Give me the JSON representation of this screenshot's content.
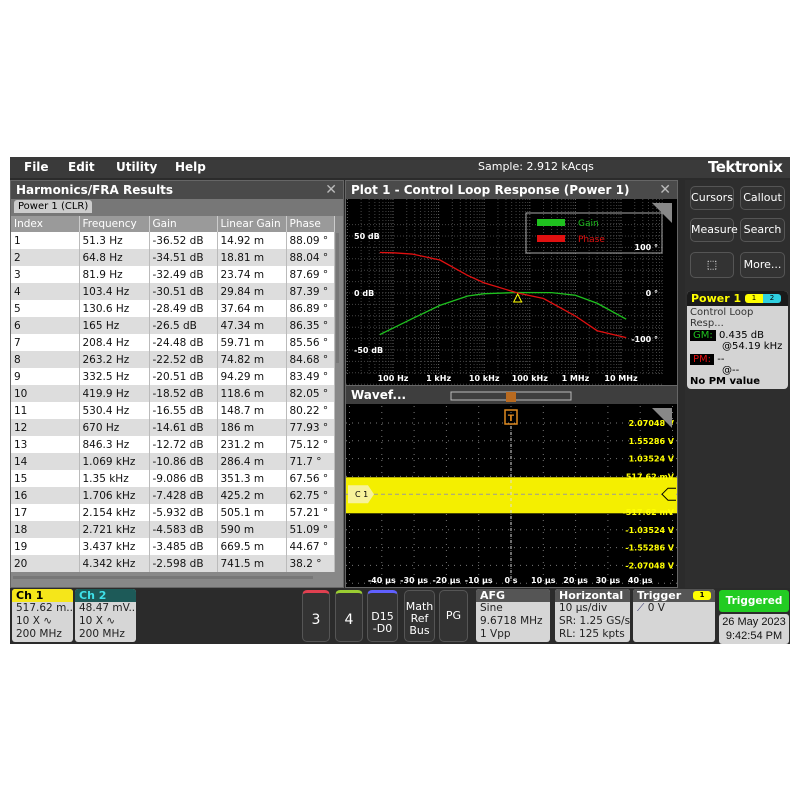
{
  "menu": {
    "items": [
      "File",
      "Edit",
      "Utility",
      "Help"
    ],
    "status": "Sample: 2.912 kAcqs",
    "brand": "Tektronix"
  },
  "results": {
    "title": "Harmonics/FRA Results",
    "tab": "Power 1 (CLR)",
    "columns": [
      "Index",
      "Frequency",
      "Gain",
      "Linear Gain",
      "Phase"
    ],
    "rows": [
      [
        "1",
        "51.3 Hz",
        "-36.52 dB",
        "14.92 m",
        "88.09 °"
      ],
      [
        "2",
        "64.8 Hz",
        "-34.51 dB",
        "18.81 m",
        "88.04 °"
      ],
      [
        "3",
        "81.9 Hz",
        "-32.49 dB",
        "23.74 m",
        "87.69 °"
      ],
      [
        "4",
        "103.4 Hz",
        "-30.51 dB",
        "29.84 m",
        "87.39 °"
      ],
      [
        "5",
        "130.6 Hz",
        "-28.49 dB",
        "37.64 m",
        "86.89 °"
      ],
      [
        "6",
        "165 Hz",
        "-26.5 dB",
        "47.34 m",
        "86.35 °"
      ],
      [
        "7",
        "208.4 Hz",
        "-24.48 dB",
        "59.71 m",
        "85.56 °"
      ],
      [
        "8",
        "263.2 Hz",
        "-22.52 dB",
        "74.82 m",
        "84.68 °"
      ],
      [
        "9",
        "332.5 Hz",
        "-20.51 dB",
        "94.29 m",
        "83.49 °"
      ],
      [
        "10",
        "419.9 Hz",
        "-18.52 dB",
        "118.6 m",
        "82.05 °"
      ],
      [
        "11",
        "530.4 Hz",
        "-16.55 dB",
        "148.7 m",
        "80.22 °"
      ],
      [
        "12",
        "670 Hz",
        "-14.61 dB",
        "186 m",
        "77.93 °"
      ],
      [
        "13",
        "846.3 Hz",
        "-12.72 dB",
        "231.2 m",
        "75.12 °"
      ],
      [
        "14",
        "1.069 kHz",
        "-10.86 dB",
        "286.4 m",
        "71.7 °"
      ],
      [
        "15",
        "1.35 kHz",
        "-9.086 dB",
        "351.3 m",
        "67.56 °"
      ],
      [
        "16",
        "1.706 kHz",
        "-7.428 dB",
        "425.2 m",
        "62.75 °"
      ],
      [
        "17",
        "2.154 kHz",
        "-5.932 dB",
        "505.1 m",
        "57.21 °"
      ],
      [
        "18",
        "2.721 kHz",
        "-4.583 dB",
        "590 m",
        "51.09 °"
      ],
      [
        "19",
        "3.437 kHz",
        "-3.485 dB",
        "669.5 m",
        "44.67 °"
      ],
      [
        "20",
        "4.342 kHz",
        "-2.598 dB",
        "741.5 m",
        "38.2 °"
      ]
    ]
  },
  "plot": {
    "title": "Plot 1 - Control Loop Response (Power 1)",
    "legend": [
      "Gain",
      "Phase"
    ],
    "left_ticks": [
      "50 dB",
      "0 dB",
      "-50 dB"
    ],
    "right_ticks": [
      "100 °",
      "0 °",
      "-100 °"
    ],
    "x_ticks": [
      "100 Hz",
      "1 kHz",
      "10 kHz",
      "100 kHz",
      "1 MHz",
      "10 MHz"
    ]
  },
  "chart_data": {
    "type": "line",
    "xscale": "log",
    "xlabel": "",
    "ylim_left": [
      -60,
      60
    ],
    "ylim_right": [
      -130,
      130
    ],
    "colors": {
      "Gain": "#1fc11f",
      "Phase": "#e01010"
    },
    "series": [
      {
        "name": "Gain",
        "unit": "dB",
        "x": [
          51.3,
          103.4,
          263.2,
          1069,
          4342,
          10000,
          54190,
          300000,
          1000000,
          3000000,
          13000000
        ],
        "values": [
          -36.52,
          -30.51,
          -22.52,
          -10.86,
          -2.598,
          -0.6,
          0.435,
          0.3,
          -2,
          -9,
          -23
        ]
      },
      {
        "name": "Phase",
        "unit": "°",
        "x": [
          51.3,
          103.4,
          263.2,
          1069,
          4342,
          10000,
          54190,
          200000,
          1000000,
          3000000,
          13000000
        ],
        "values": [
          88.09,
          87.39,
          84.68,
          71.7,
          38.2,
          22,
          0,
          -12,
          -50,
          -82,
          -97
        ]
      }
    ]
  },
  "waveform": {
    "title": "Wavef...",
    "channel_label": "C 1",
    "trigger_label": "T",
    "y_ticks": [
      "2.07048 V",
      "1.55286 V",
      "1.03524 V",
      "517.62 mV",
      "-517.62 mV",
      "-1.03524 V",
      "-1.55286 V",
      "-2.07048 V"
    ],
    "x_ticks": [
      "-40 µs",
      "-30 µs",
      "-20 µs",
      "-10 µs",
      "0 s",
      "10 µs",
      "20 µs",
      "30 µs",
      "40 µs"
    ]
  },
  "side": {
    "buttons": [
      "Cursors",
      "Callout",
      "Measure",
      "Search",
      "More..."
    ],
    "power": {
      "title": "Power 1",
      "badges": [
        "1",
        "2"
      ],
      "name": "Control Loop Resp...",
      "gm_label": "GM:",
      "gm": "0.435 dB",
      "gm_at": "@54.19 kHz",
      "pm_label": "PM:",
      "pm": "--",
      "pm_at": "@--",
      "note": "No PM value"
    }
  },
  "bottom": {
    "ch1": {
      "title": "Ch 1",
      "value": "517.62 m...",
      "probe": "10 X",
      "bw": "200 MHz"
    },
    "ch2": {
      "title": "Ch 2",
      "value": "48.47 mV...",
      "probe": "10 X",
      "bw": "200 MHz"
    },
    "buttons": [
      "3",
      "4",
      "D15\n-D0",
      "Math\nRef\nBus",
      "PG"
    ],
    "afg": {
      "title": "AFG",
      "lines": [
        "Sine",
        "9.6718 MHz",
        "1 Vpp"
      ]
    },
    "horizontal": {
      "title": "Horizontal",
      "lines": [
        "10 µs/div",
        "SR: 1.25 GS/s",
        "RL: 125 kpts"
      ]
    },
    "trigger": {
      "title": "Trigger",
      "source": "1",
      "level": "0 V"
    },
    "status": "Triggered",
    "date": "26 May 2023",
    "time": "9:42:54 PM"
  }
}
